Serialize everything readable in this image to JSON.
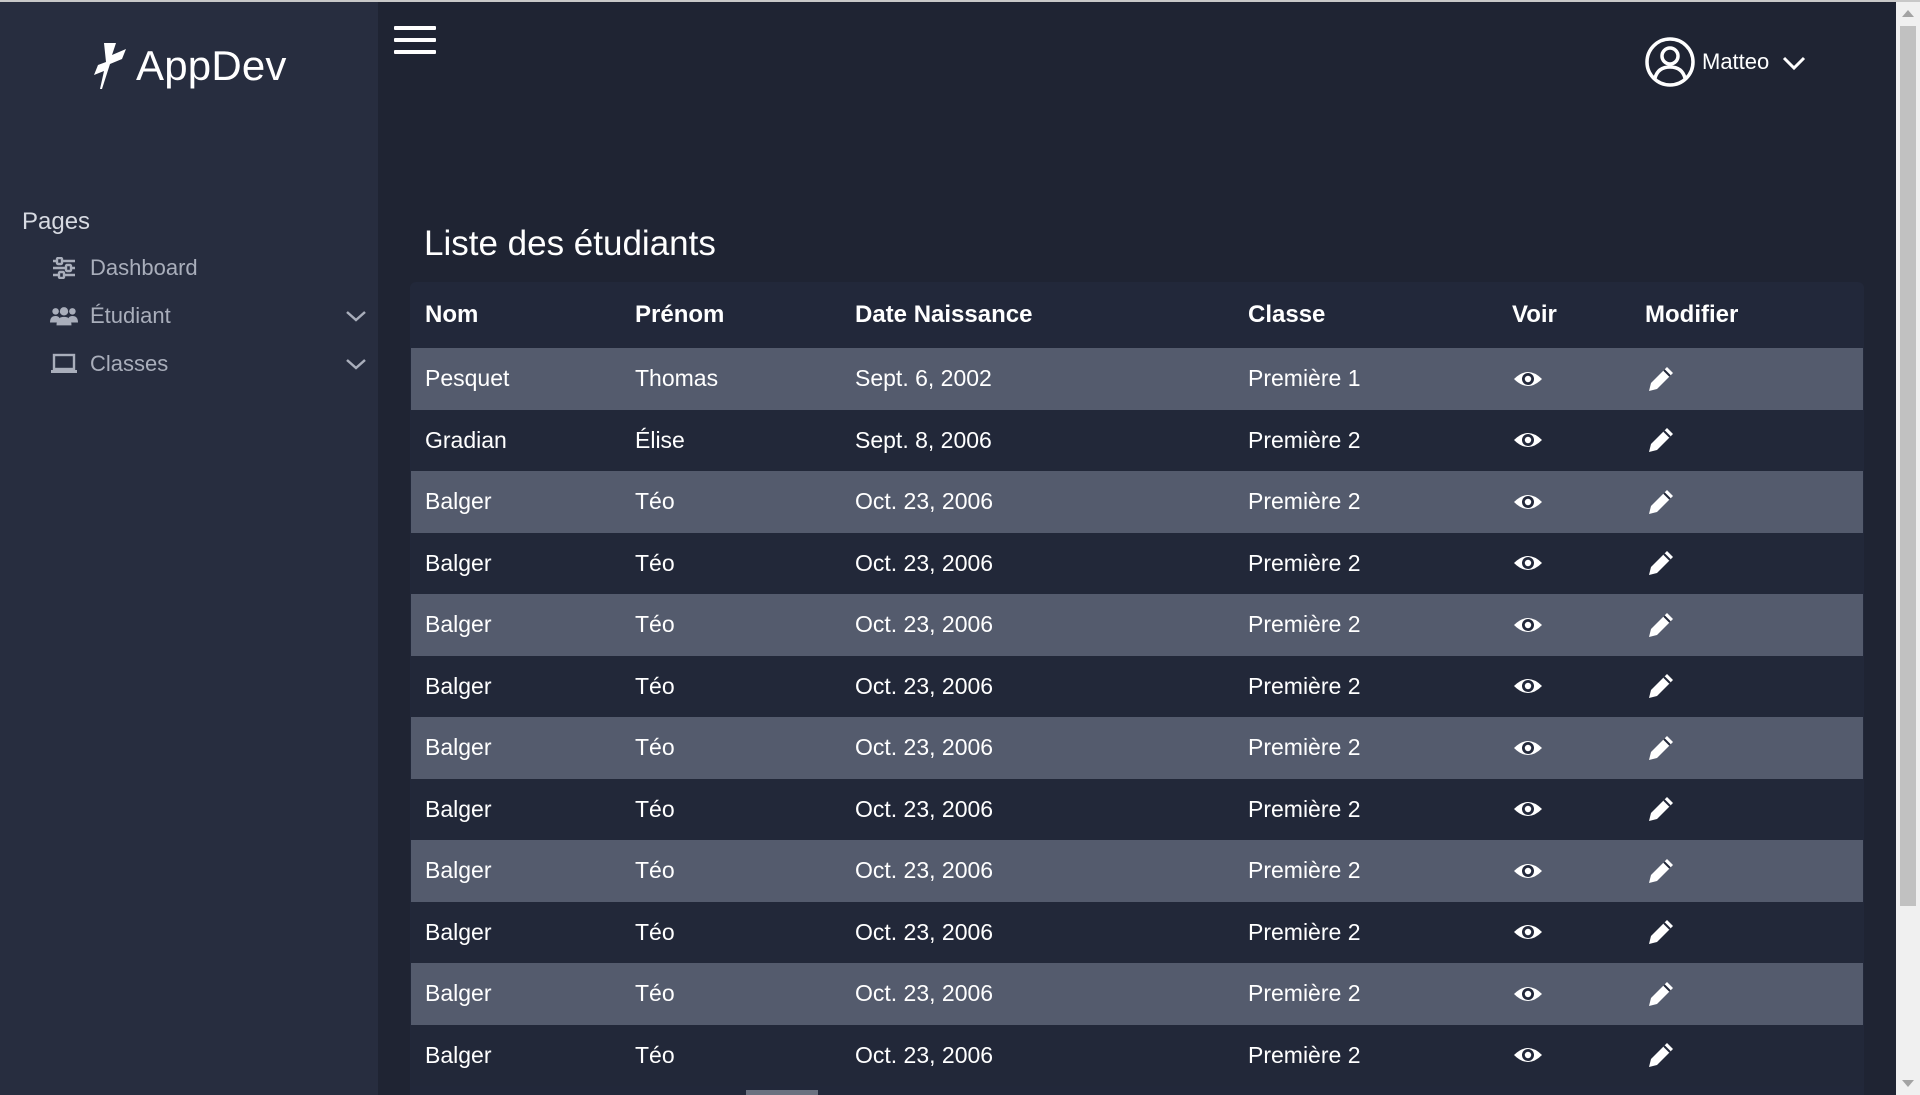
{
  "app": {
    "name": "AppDev"
  },
  "sidebar": {
    "heading": "Pages",
    "items": [
      {
        "label": "Dashboard",
        "icon": "sliders-icon",
        "expandable": false
      },
      {
        "label": "Étudiant",
        "icon": "users-icon",
        "expandable": true
      },
      {
        "label": "Classes",
        "icon": "laptop-icon",
        "expandable": true
      }
    ]
  },
  "header": {
    "user": {
      "name": "Matteo"
    }
  },
  "main": {
    "title": "Liste des étudiants",
    "columns": [
      "Nom",
      "Prénom",
      "Date Naissance",
      "Classe",
      "Voir",
      "Modifier"
    ],
    "rows": [
      [
        "Pesquet",
        "Thomas",
        "Sept. 6, 2002",
        "Première 1"
      ],
      [
        "Gradian",
        "Élise",
        "Sept. 8, 2006",
        "Première 2"
      ],
      [
        "Balger",
        "Téo",
        "Oct. 23, 2006",
        "Première 2"
      ],
      [
        "Balger",
        "Téo",
        "Oct. 23, 2006",
        "Première 2"
      ],
      [
        "Balger",
        "Téo",
        "Oct. 23, 2006",
        "Première 2"
      ],
      [
        "Balger",
        "Téo",
        "Oct. 23, 2006",
        "Première 2"
      ],
      [
        "Balger",
        "Téo",
        "Oct. 23, 2006",
        "Première 2"
      ],
      [
        "Balger",
        "Téo",
        "Oct. 23, 2006",
        "Première 2"
      ],
      [
        "Balger",
        "Téo",
        "Oct. 23, 2006",
        "Première 2"
      ],
      [
        "Balger",
        "Téo",
        "Oct. 23, 2006",
        "Première 2"
      ],
      [
        "Balger",
        "Téo",
        "Oct. 23, 2006",
        "Première 2"
      ],
      [
        "Balger",
        "Téo",
        "Oct. 23, 2006",
        "Première 2"
      ]
    ]
  },
  "colors": {
    "background": "#1f2433",
    "sidebar": "#272d3f",
    "row_even": "#545b6d",
    "row_odd": "#222839",
    "text": "#ffffff",
    "muted_text": "#a9aebb"
  }
}
